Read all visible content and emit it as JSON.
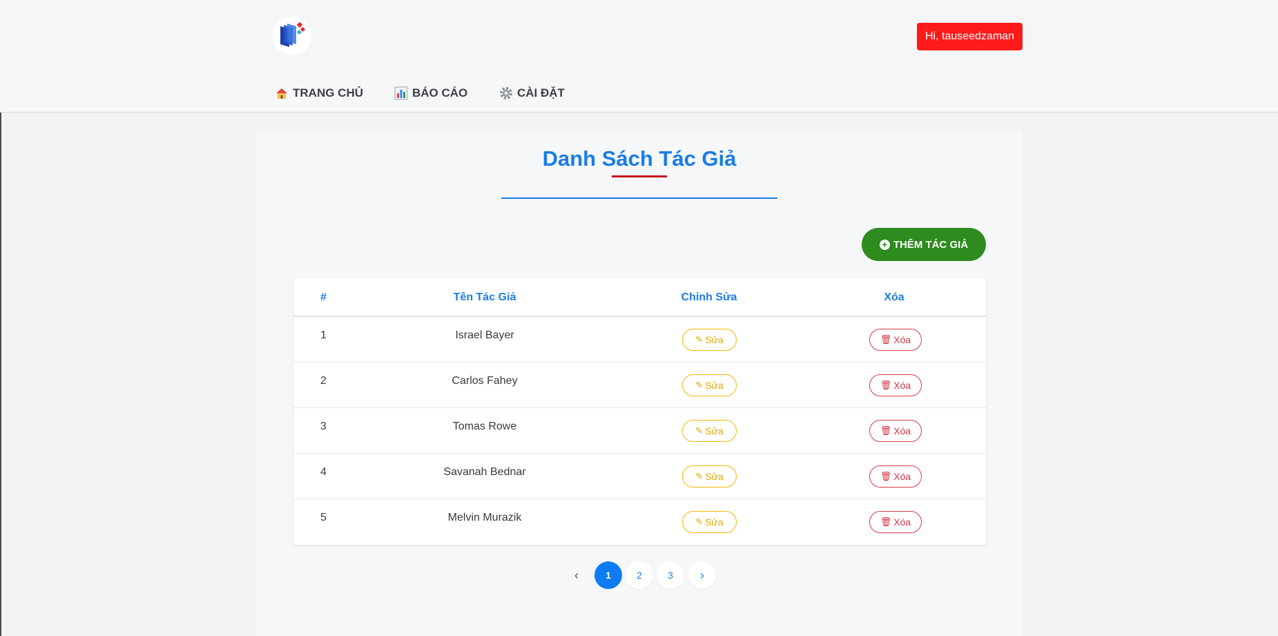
{
  "header": {
    "logo_icon": "book-logo-icon",
    "user_greeting": "Hi, tauseedzaman",
    "user_button_color": "#ff1a1a"
  },
  "nav": {
    "items": [
      {
        "label": "TRANG CHỦ",
        "icon": "home-icon"
      },
      {
        "label": "BÁO CÁO",
        "icon": "bar-chart-icon"
      },
      {
        "label": "CÀI ĐẶT",
        "icon": "gear-icon"
      }
    ]
  },
  "main": {
    "title": "Danh Sách Tác Giả",
    "add_button_label": "THÊM TÁC GIẢ",
    "accent_color": "#1a7de6",
    "add_button_color": "#2e8b1e"
  },
  "table": {
    "headers": [
      "#",
      "Tên Tác Giả",
      "Chỉnh Sửa",
      "Xóa"
    ],
    "edit_label": "Sửa",
    "delete_label": "Xóa",
    "rows": [
      {
        "num": "1",
        "name": "Israel Bayer"
      },
      {
        "num": "2",
        "name": "Carlos Fahey"
      },
      {
        "num": "3",
        "name": "Tomas Rowe"
      },
      {
        "num": "4",
        "name": "Savanah Bednar"
      },
      {
        "num": "5",
        "name": "Melvin Murazik"
      }
    ]
  },
  "pagination": {
    "prev": "‹",
    "pages": [
      "1",
      "2",
      "3"
    ],
    "current": "1",
    "next": "›"
  }
}
